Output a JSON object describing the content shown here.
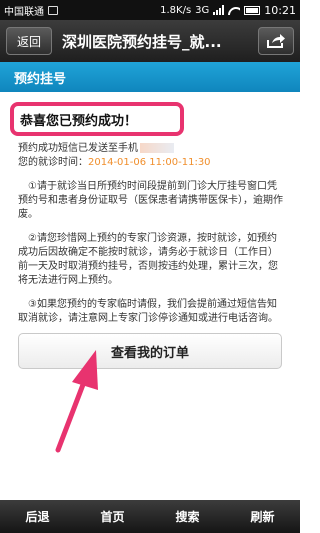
{
  "status_bar": {
    "carrier": "中国联通",
    "speed": "1.8K/s",
    "network": "3G",
    "time": "10:21"
  },
  "header": {
    "back_label": "返回",
    "title": "深圳医院预约挂号_就..."
  },
  "section": {
    "title": "预约挂号"
  },
  "main": {
    "success_message": "恭喜您已预约成功！",
    "sms_notice": "预约成功短信已发送至手机",
    "visit_time_label": "您的就诊时间：",
    "visit_time_value": "2014-01-06 11:00-11:30",
    "note_1": "①请于就诊当日所预约时间段提前到门诊大厅挂号窗口凭预约号和患者身份证取号（医保患者请携带医保卡），逾期作废。",
    "note_2": "②请您珍惜网上预约的专家门诊资源，按时就诊，如预约成功后因故确定不能按时就诊，请务必于就诊日（工作日）前一天及时取消预约挂号，否则按违约处理，累计三次，您将无法进行网上预约。",
    "note_3": "③如果您预约的专家临时请假，我们会提前通过短信告知取消就诊，请注意网上专家门诊停诊通知或进行电话咨询。",
    "view_order_label": "查看我的订单"
  },
  "bottom_nav": {
    "back": "后退",
    "home": "首页",
    "search": "搜索",
    "refresh": "刷新"
  },
  "colors": {
    "accent": "#1a9ad2",
    "highlight_border": "#e8336f",
    "visit_time": "#f08f2d"
  }
}
